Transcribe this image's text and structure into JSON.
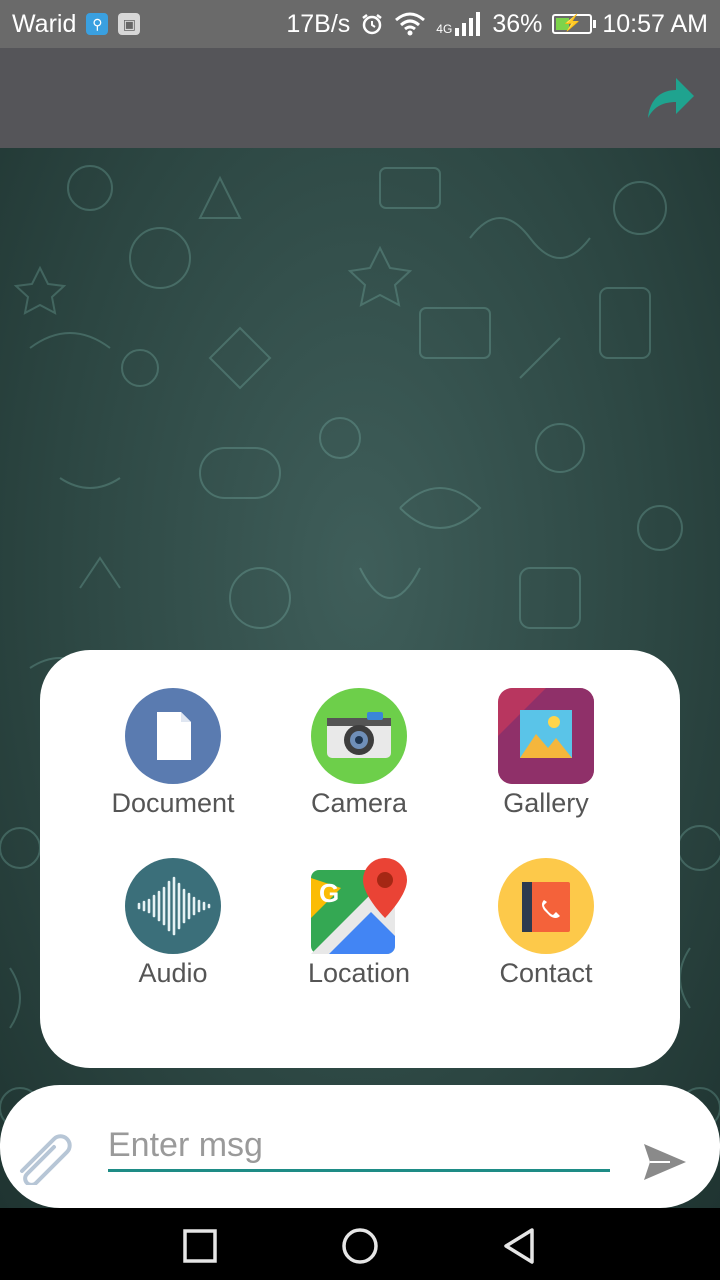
{
  "status_bar": {
    "carrier": "Warid",
    "net_speed": "17B/s",
    "network_type": "4G",
    "battery": "36%",
    "battery_level": 0.36,
    "time": "10:57 AM",
    "icons": [
      "usb-icon",
      "image-notification-icon",
      "alarm-icon",
      "wifi-icon",
      "signal-icon",
      "battery-icon"
    ]
  },
  "toolbar": {
    "forward_icon": "forward-arrow-icon",
    "accent": "#1fa38f"
  },
  "attachments": [
    {
      "label": "Document",
      "icon": "document-icon",
      "color": "#5a7bb0"
    },
    {
      "label": "Camera",
      "icon": "camera-icon",
      "color": "#6dcf4a"
    },
    {
      "label": "Gallery",
      "icon": "gallery-icon",
      "color": "#8e3b6f"
    },
    {
      "label": "Audio",
      "icon": "audio-waveform-icon",
      "color": "#3b6f7a"
    },
    {
      "label": "Location",
      "icon": "maps-location-icon",
      "color": "#34a853"
    },
    {
      "label": "Contact",
      "icon": "contact-book-icon",
      "color": "#fdc94a"
    }
  ],
  "composer": {
    "placeholder": "Enter msg",
    "value": "",
    "attach_icon": "paperclip-icon",
    "send_icon": "send-icon",
    "underline_color": "#1e8c86"
  },
  "nav_bar": {
    "buttons": [
      "recents-square-icon",
      "home-circle-icon",
      "back-triangle-icon"
    ]
  }
}
